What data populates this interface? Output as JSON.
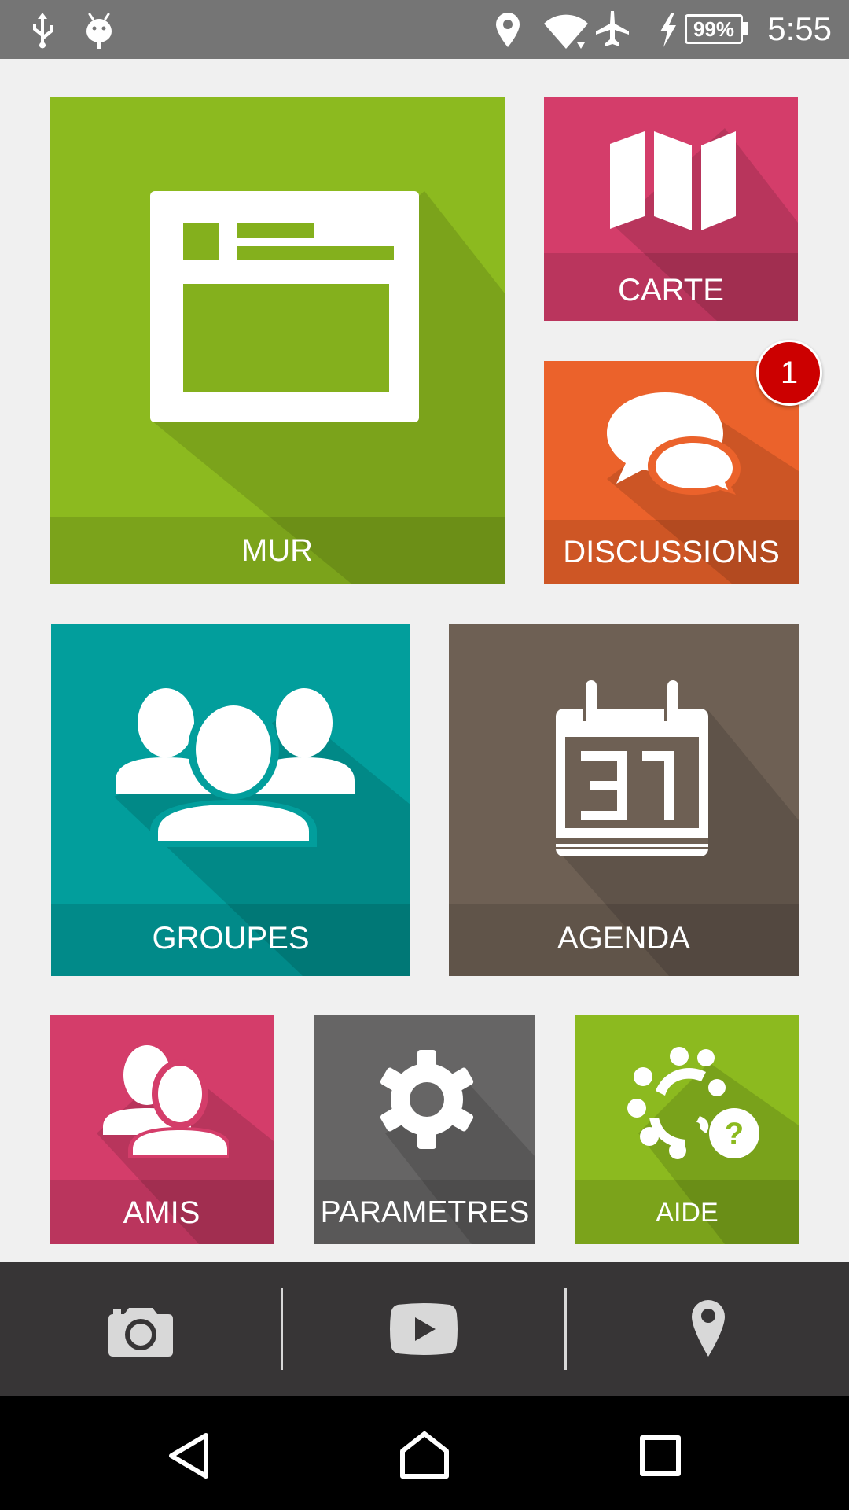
{
  "status_bar": {
    "time": "5:55",
    "battery_percent": "99%",
    "icons": [
      "usb-icon",
      "android-debug-icon",
      "location-icon",
      "wifi-icon",
      "airplane-mode-icon",
      "charging-icon"
    ]
  },
  "tiles": {
    "mur": {
      "label": "MUR",
      "color": "#8cba1f",
      "icon": "wall-news-icon"
    },
    "carte": {
      "label": "CARTE",
      "color": "#d43d6a",
      "icon": "map-icon"
    },
    "discussions": {
      "label": "DISCUSSIONS",
      "color": "#eb622b",
      "icon": "chat-bubbles-icon",
      "badge": "1"
    },
    "groupes": {
      "label": "GROUPES",
      "color": "#029e9c",
      "icon": "group-icon"
    },
    "agenda": {
      "label": "AGENDA",
      "color": "#6e6054",
      "icon": "calendar-icon"
    },
    "amis": {
      "label": "AMIS",
      "color": "#d43d6a",
      "icon": "friends-icon"
    },
    "parametres": {
      "label": "PARAMETRES",
      "color": "#666565",
      "icon": "gear-icon"
    },
    "aide": {
      "label": "AIDE",
      "color": "#8cba1f",
      "icon": "help-community-icon"
    }
  },
  "toolbar": {
    "items": [
      "camera-icon",
      "video-play-icon",
      "map-pin-icon"
    ]
  },
  "navbar": {
    "items": [
      "back-icon",
      "home-icon",
      "recents-icon"
    ]
  }
}
